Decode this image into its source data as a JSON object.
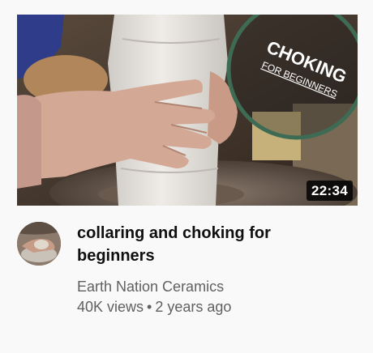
{
  "video": {
    "thumbnail_overlay": {
      "line1": "CHOKING",
      "line2": "FOR BEGINNERS"
    },
    "duration": "22:34",
    "title": "collaring and choking for beginners",
    "channel": "Earth Nation Ceramics",
    "views": "40K views",
    "separator": "•",
    "age": "2 years ago"
  },
  "colors": {
    "title": "#0f0f0f",
    "secondary_text": "#606060",
    "background": "#f9f9f9",
    "overlay_ring": "#3e6b54",
    "duration_badge_bg": "#000000"
  }
}
